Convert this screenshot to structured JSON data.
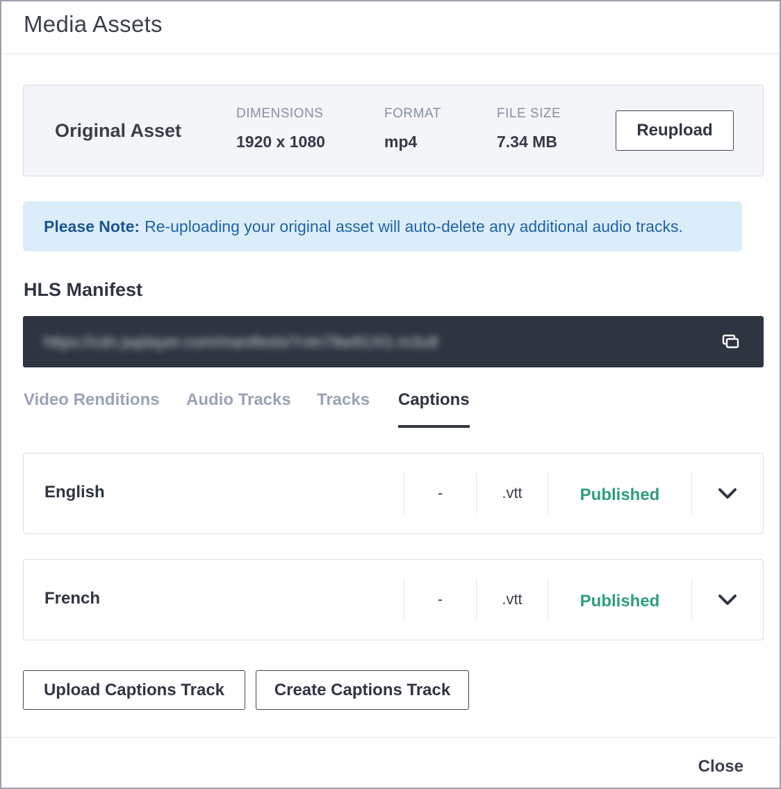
{
  "modal": {
    "title": "Media Assets"
  },
  "original_asset": {
    "title": "Original Asset",
    "dimensions_label": "DIMENSIONS",
    "dimensions_value": "1920 x 1080",
    "format_label": "FORMAT",
    "format_value": "mp4",
    "file_size_label": "FILE SIZE",
    "file_size_value": "7.34 MB",
    "reupload_label": "Reupload"
  },
  "note": {
    "label": "Please Note:",
    "text": "Re-uploading your original asset will auto-delete any additional audio tracks."
  },
  "hls": {
    "title": "HLS Manifest",
    "url": "https://cdn.jwplayer.com/manifests/Yxtn78w91XG.m3u8",
    "copy_icon": "copy-icon"
  },
  "tabs": [
    {
      "label": "Video Renditions",
      "active": false
    },
    {
      "label": "Audio Tracks",
      "active": false
    },
    {
      "label": "Tracks",
      "active": false
    },
    {
      "label": "Captions",
      "active": true
    }
  ],
  "captions": [
    {
      "language": "English",
      "dash": "-",
      "extension": ".vtt",
      "status": "Published"
    },
    {
      "language": "French",
      "dash": "-",
      "extension": ".vtt",
      "status": "Published"
    }
  ],
  "actions": {
    "upload_label": "Upload Captions Track",
    "create_label": "Create Captions Track"
  },
  "footer": {
    "close_label": "Close"
  },
  "colors": {
    "published": "#2e9e79",
    "note_bg": "#dcedfa",
    "manifest_bg": "#2f3441"
  }
}
